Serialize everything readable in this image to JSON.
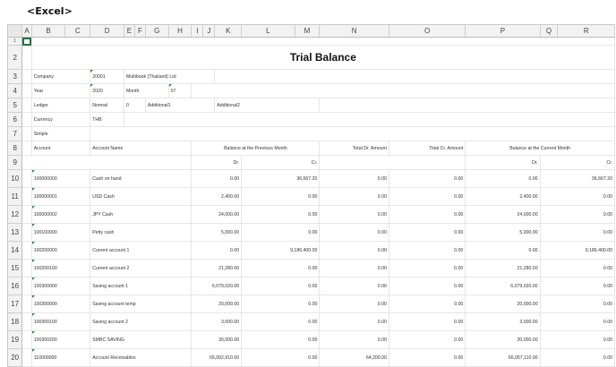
{
  "caption": "<Excel>",
  "columns": [
    "A",
    "B",
    "C",
    "D",
    "E",
    "F",
    "G",
    "H",
    "I",
    "J",
    "K",
    "L",
    "M",
    "N",
    "O",
    "P",
    "Q",
    "R"
  ],
  "rows": [
    "1",
    "2",
    "3",
    "4",
    "5",
    "6",
    "7",
    "8",
    "9",
    "10",
    "11",
    "12",
    "13",
    "14",
    "15",
    "16",
    "17",
    "18",
    "19",
    "20"
  ],
  "title": "Trial Balance",
  "params": {
    "company_label": "Company",
    "company_code": "20001",
    "company_name": "Multibook (Thailand) Ltd",
    "year_label": "Year",
    "year_value": "2020",
    "month_label": "Month",
    "month_value": "07",
    "ledger_label": "Ledger",
    "ledger_value": "Normal",
    "ledger_extra": "0",
    "additional1_label": "Additional1",
    "additional2_label": "Additional2",
    "currency_label": "Currency",
    "currency_value": "THB",
    "simple_label": "Simple"
  },
  "headers": {
    "account": "Account",
    "account_name": "Account Name",
    "prev_month": "Balance at the Previous Month",
    "total_dr": "Total Dr. Amount",
    "total_cr": "Total Cr. Amount",
    "current_month": "Balance at the Current Month",
    "dr": "Dr.",
    "cr": "Cr.",
    "dr2": "Dr.",
    "cr2": "Cr."
  },
  "accounts": [
    {
      "code": "100000000",
      "name": "Cash on hand",
      "prev_dr": "0.00",
      "prev_cr": "36,667.20",
      "total_dr": "0.00",
      "total_cr": "0.00",
      "cur_dr": "0.00",
      "cur_cr": "36,667.20"
    },
    {
      "code": "100000001",
      "name": "USD Cash",
      "prev_dr": "2,400.00",
      "prev_cr": "0.00",
      "total_dr": "0.00",
      "total_cr": "0.00",
      "cur_dr": "2,400.00",
      "cur_cr": "0.00"
    },
    {
      "code": "100000002",
      "name": "JPY Cash",
      "prev_dr": "24,000.00",
      "prev_cr": "0.00",
      "total_dr": "0.00",
      "total_cr": "0.00",
      "cur_dr": "24,000.00",
      "cur_cr": "0.00"
    },
    {
      "code": "100100000",
      "name": "Petty cash",
      "prev_dr": "5,000.00",
      "prev_cr": "0.00",
      "total_dr": "0.00",
      "total_cr": "0.00",
      "cur_dr": "5,000.00",
      "cur_cr": "0.00"
    },
    {
      "code": "100200000",
      "name": "Current account 1",
      "prev_dr": "0.00",
      "prev_cr": "9,186,400.00",
      "total_dr": "0.00",
      "total_cr": "0.00",
      "cur_dr": "0.00",
      "cur_cr": "9,186,400.00"
    },
    {
      "code": "100200100",
      "name": "Current account 2",
      "prev_dr": "21,280.00",
      "prev_cr": "0.00",
      "total_dr": "0.00",
      "total_cr": "0.00",
      "cur_dr": "21,280.00",
      "cur_cr": "0.00"
    },
    {
      "code": "100300000",
      "name": "Saving account 1",
      "prev_dr": "6,079,020.00",
      "prev_cr": "0.00",
      "total_dr": "0.00",
      "total_cr": "0.00",
      "cur_dr": "6,079,020.00",
      "cur_cr": "0.00"
    },
    {
      "code": "100300000",
      "name": "Saving account temp",
      "prev_dr": "20,000.00",
      "prev_cr": "0.00",
      "total_dr": "0.00",
      "total_cr": "0.00",
      "cur_dr": "20,000.00",
      "cur_cr": "0.00"
    },
    {
      "code": "100300100",
      "name": "Saving account 2",
      "prev_dr": "3,000.00",
      "prev_cr": "0.00",
      "total_dr": "0.00",
      "total_cr": "0.00",
      "cur_dr": "3,000.00",
      "cur_cr": "0.00"
    },
    {
      "code": "100300200",
      "name": "SMBC SAVING",
      "prev_dr": "30,000.00",
      "prev_cr": "0.00",
      "total_dr": "0.00",
      "total_cr": "0.00",
      "cur_dr": "30,000.00",
      "cur_cr": "0.00"
    },
    {
      "code": "110000000",
      "name": "Account Receivables",
      "prev_dr": "65,992,910.00",
      "prev_cr": "0.00",
      "total_dr": "64,200.00",
      "total_cr": "0.00",
      "cur_dr": "66,057,110.00",
      "cur_cr": "0.00"
    }
  ],
  "colors": {
    "header_bg": "#f2f2f2",
    "marker_green": "#1f8f3a",
    "cursor": "#217346"
  }
}
